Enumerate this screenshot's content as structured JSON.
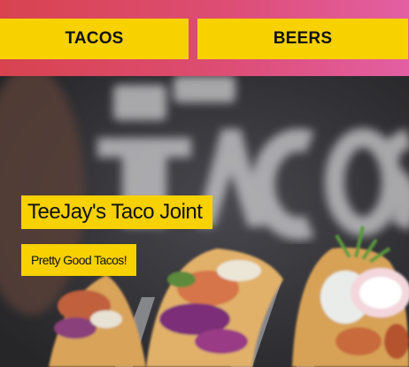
{
  "nav": {
    "tacos_label": "TACOS",
    "beers_label": "BEERS"
  },
  "hero": {
    "title": "TeeJay's Taco Joint",
    "button_label": "Pretty Good Tacos!",
    "image_icon": "tacos-photo"
  },
  "colors": {
    "accent": "#f7d100",
    "header_gradient_start": "#d8434f",
    "header_gradient_end": "#e35fa3"
  }
}
